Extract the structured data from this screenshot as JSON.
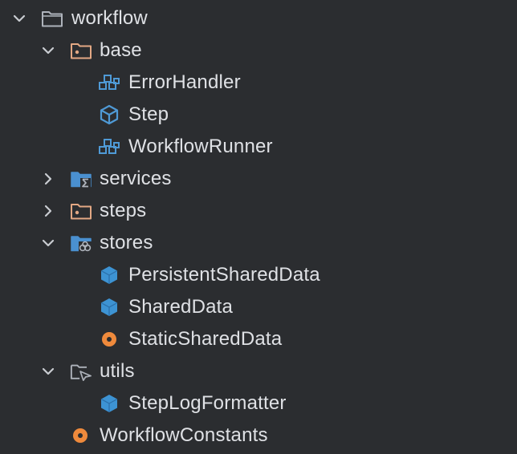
{
  "tree": {
    "root": {
      "label": "workflow",
      "expanded": true,
      "icon": "folder-icon"
    },
    "base": {
      "label": "base",
      "expanded": true,
      "icon": "package-folder-icon",
      "children": [
        {
          "label": "ErrorHandler",
          "icon": "class-icon"
        },
        {
          "label": "Step",
          "icon": "interface-icon"
        },
        {
          "label": "WorkflowRunner",
          "icon": "class-icon"
        }
      ]
    },
    "services": {
      "label": "services",
      "expanded": false,
      "icon": "services-folder-icon"
    },
    "steps": {
      "label": "steps",
      "expanded": false,
      "icon": "package-folder-icon"
    },
    "stores": {
      "label": "stores",
      "expanded": true,
      "icon": "stores-folder-icon",
      "children": [
        {
          "label": "PersistentSharedData",
          "icon": "struct-icon"
        },
        {
          "label": "SharedData",
          "icon": "struct-icon"
        },
        {
          "label": "StaticSharedData",
          "icon": "object-icon"
        }
      ]
    },
    "utils": {
      "label": "utils",
      "expanded": true,
      "icon": "excluded-folder-icon",
      "children": [
        {
          "label": "StepLogFormatter",
          "icon": "struct-icon"
        }
      ]
    },
    "constants": {
      "label": "WorkflowConstants",
      "icon": "object-icon"
    }
  },
  "colors": {
    "background": "#2b2d30",
    "text": "#dfe1e5",
    "chevron": "#c9ccd1",
    "folder_outline": "#aeb3bb",
    "package_folder": "#e3a884",
    "class_icon": "#4f9ad6",
    "struct_icon": "#3d93d3",
    "object_icon": "#ef8a3c"
  }
}
